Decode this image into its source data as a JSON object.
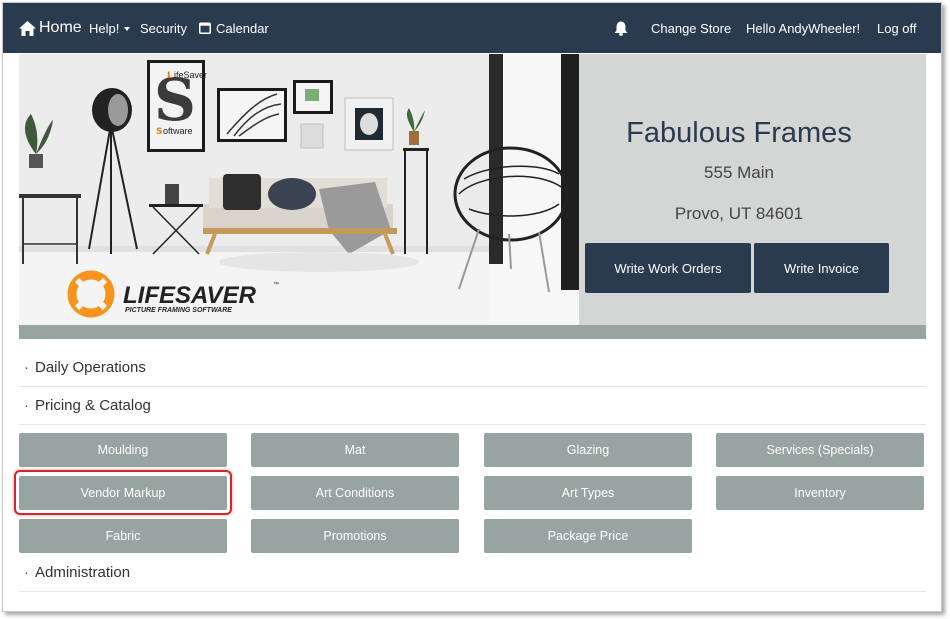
{
  "navbar": {
    "home": "Home",
    "help": "Help!",
    "security": "Security",
    "calendar": "Calendar",
    "change_store": "Change Store",
    "hello": "Hello AndyWheeler!",
    "log_off": "Log off",
    "icons": [
      "home-icon",
      "caret-down-icon",
      "calendar-icon",
      "bell-icon"
    ]
  },
  "hero": {
    "logo_top": "ifeSaver",
    "logo_bottom": "oftware",
    "brand_main": "LIFESAVER",
    "brand_tm": "™",
    "brand_sub": "PICTURE FRAMING SOFTWARE",
    "store_name": "Fabulous Frames",
    "address_line1": "555 Main",
    "address_line2": "Provo, UT 84601",
    "write_work_orders": "Write Work Orders",
    "write_invoice": "Write Invoice"
  },
  "sections": {
    "daily_operations": "Daily Operations",
    "pricing_catalog": "Pricing & Catalog",
    "administration": "Administration",
    "bullet": "·"
  },
  "tiles": {
    "moulding": "Moulding",
    "mat": "Mat",
    "glazing": "Glazing",
    "services": "Services (Specials)",
    "vendor_markup": "Vendor Markup",
    "art_conditions": "Art Conditions",
    "art_types": "Art Types",
    "inventory": "Inventory",
    "fabric": "Fabric",
    "promotions": "Promotions",
    "package_price": "Package Price"
  },
  "colors": {
    "navbar": "#2b3b4f",
    "tile": "#97a4a1",
    "panel": "#d3d6d5",
    "highlight": "#d0262e",
    "brand_orange": "#f7941d"
  }
}
